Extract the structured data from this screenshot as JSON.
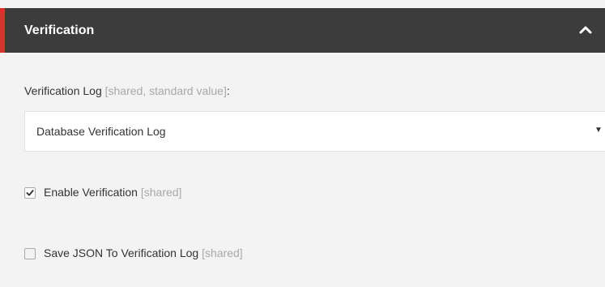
{
  "section": {
    "title": "Verification"
  },
  "verification_log": {
    "label": "Verification Log",
    "hint": "[shared, standard value]",
    "colon": ":",
    "selected_value": "Database Verification Log",
    "arrow_glyph": "▼"
  },
  "enable_verification": {
    "label": "Enable Verification",
    "hint": "[shared]",
    "checked": true
  },
  "save_json": {
    "label": "Save JSON To Verification Log",
    "hint": "[shared]",
    "checked": false
  },
  "colors": {
    "header_bg": "#3c3c3c",
    "accent": "#d9322e",
    "panel_bg": "#f3f3f3",
    "hint_text": "#a8a8a8"
  },
  "icons": {
    "collapse": "chevron-up-icon",
    "checkmark": "checkmark-icon",
    "dropdown": "caret-down-icon"
  }
}
